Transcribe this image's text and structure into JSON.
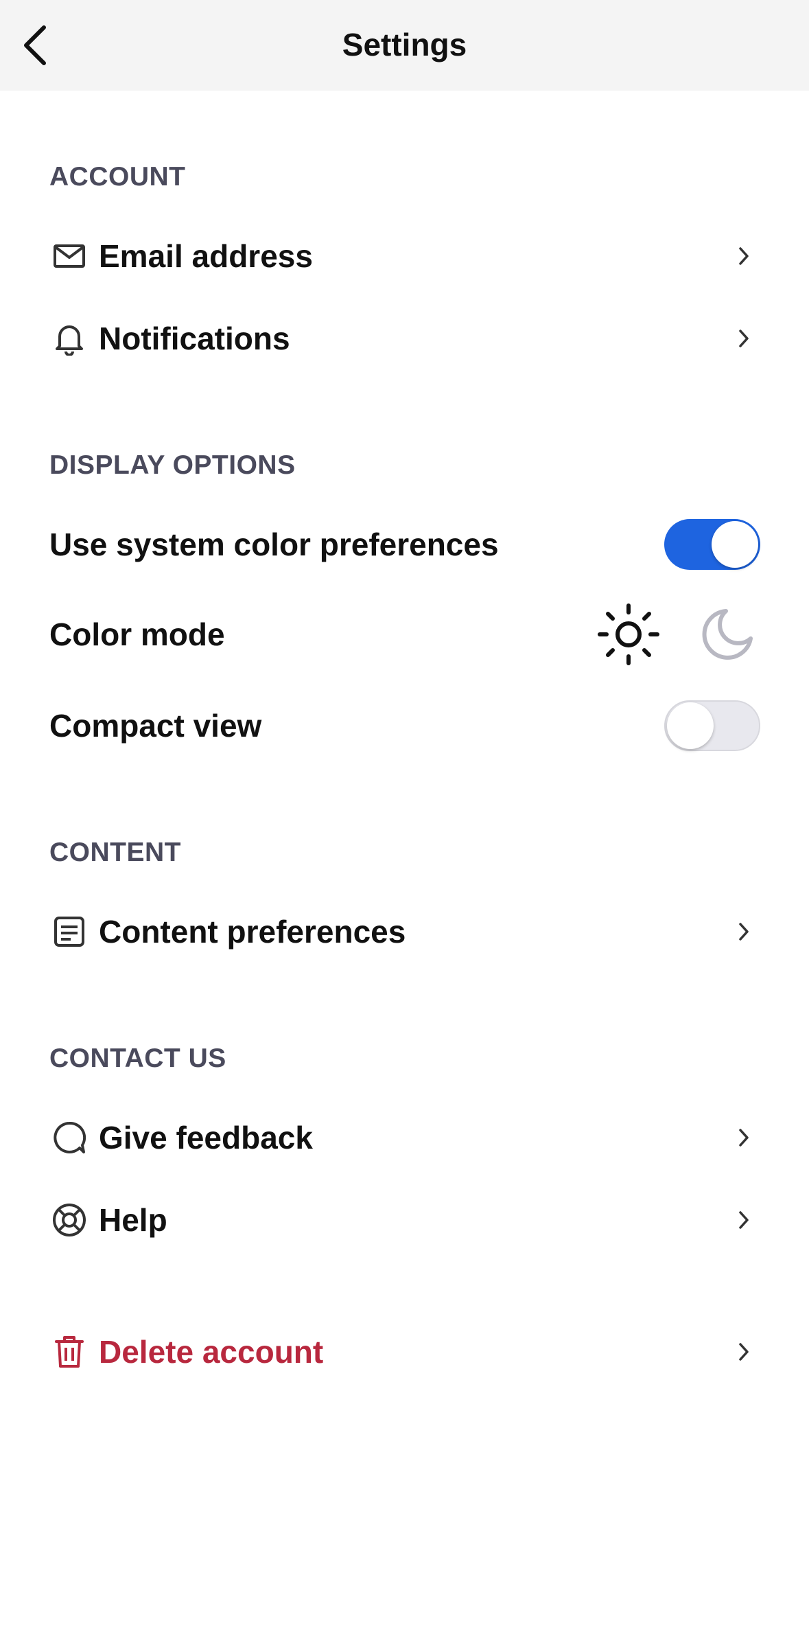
{
  "header": {
    "title": "Settings",
    "back_icon": "chevron-left-icon"
  },
  "sections": {
    "account": {
      "title": "ACCOUNT",
      "items": [
        {
          "label": "Email address",
          "icon": "mail-icon"
        },
        {
          "label": "Notifications",
          "icon": "bell-icon"
        }
      ]
    },
    "display": {
      "title": "DISPLAY OPTIONS",
      "system_color": {
        "label": "Use system color preferences",
        "enabled": true
      },
      "color_mode": {
        "label": "Color mode",
        "selected": "light",
        "options": [
          "sun-icon",
          "moon-icon"
        ]
      },
      "compact_view": {
        "label": "Compact view",
        "enabled": false
      }
    },
    "content": {
      "title": "CONTENT",
      "items": [
        {
          "label": "Content preferences",
          "icon": "document-icon"
        }
      ]
    },
    "contact": {
      "title": "CONTACT US",
      "items": [
        {
          "label": "Give feedback",
          "icon": "chat-bubble-icon"
        },
        {
          "label": "Help",
          "icon": "lifebuoy-icon"
        }
      ]
    }
  },
  "danger": {
    "label": "Delete account",
    "icon": "trash-icon"
  },
  "colors": {
    "toggle_on": "#1e64e0",
    "danger": "#b8283e",
    "section_title": "#4a4a5c",
    "header_bg": "#f4f4f4"
  }
}
